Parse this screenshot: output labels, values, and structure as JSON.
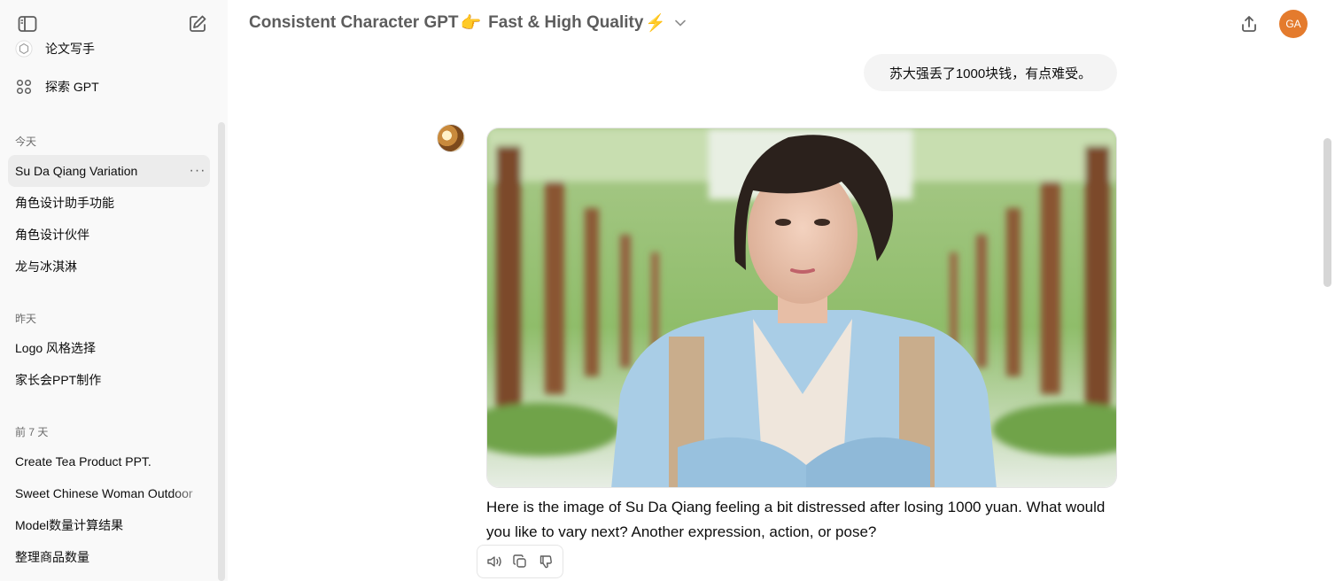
{
  "sidebar": {
    "nav": [
      {
        "label": "论文写手",
        "icon": "gpt-avatar-icon"
      },
      {
        "label": "探索 GPT",
        "icon": "grid-icon"
      }
    ],
    "sections": [
      {
        "title": "今天",
        "items": [
          "Su Da Qiang Variation",
          "角色设计助手功能",
          "角色设计伙伴",
          "龙与冰淇淋"
        ]
      },
      {
        "title": "昨天",
        "items": [
          "Logo 风格选择",
          "家长会PPT制作"
        ]
      },
      {
        "title": "前 7 天",
        "items": [
          "Create Tea Product PPT.",
          "Sweet Chinese Woman Outdoor",
          "Model数量计算结果",
          "整理商品数量"
        ]
      }
    ],
    "active_item": "Su Da Qiang Variation",
    "more_label": "···"
  },
  "header": {
    "title": "Consistent Character GPT",
    "title_emoji_1": "👉",
    "subtitle": "Fast & High Quality",
    "title_emoji_2": "⚡",
    "avatar_initials": "GA"
  },
  "chat": {
    "user_message": "苏大强丢了1000块钱，有点难受。",
    "assistant_reply": "Here is the image of Su Da Qiang feeling a bit distressed after losing 1000 yuan. What would you like to vary next? Another expression, action, or pose?"
  },
  "colors": {
    "sidebar_bg": "#f9f9f9",
    "active_item_bg": "#ececec",
    "user_bubble_bg": "#f4f4f4",
    "avatar_bg": "#e47b2d",
    "title_color": "#5d5d5d"
  }
}
